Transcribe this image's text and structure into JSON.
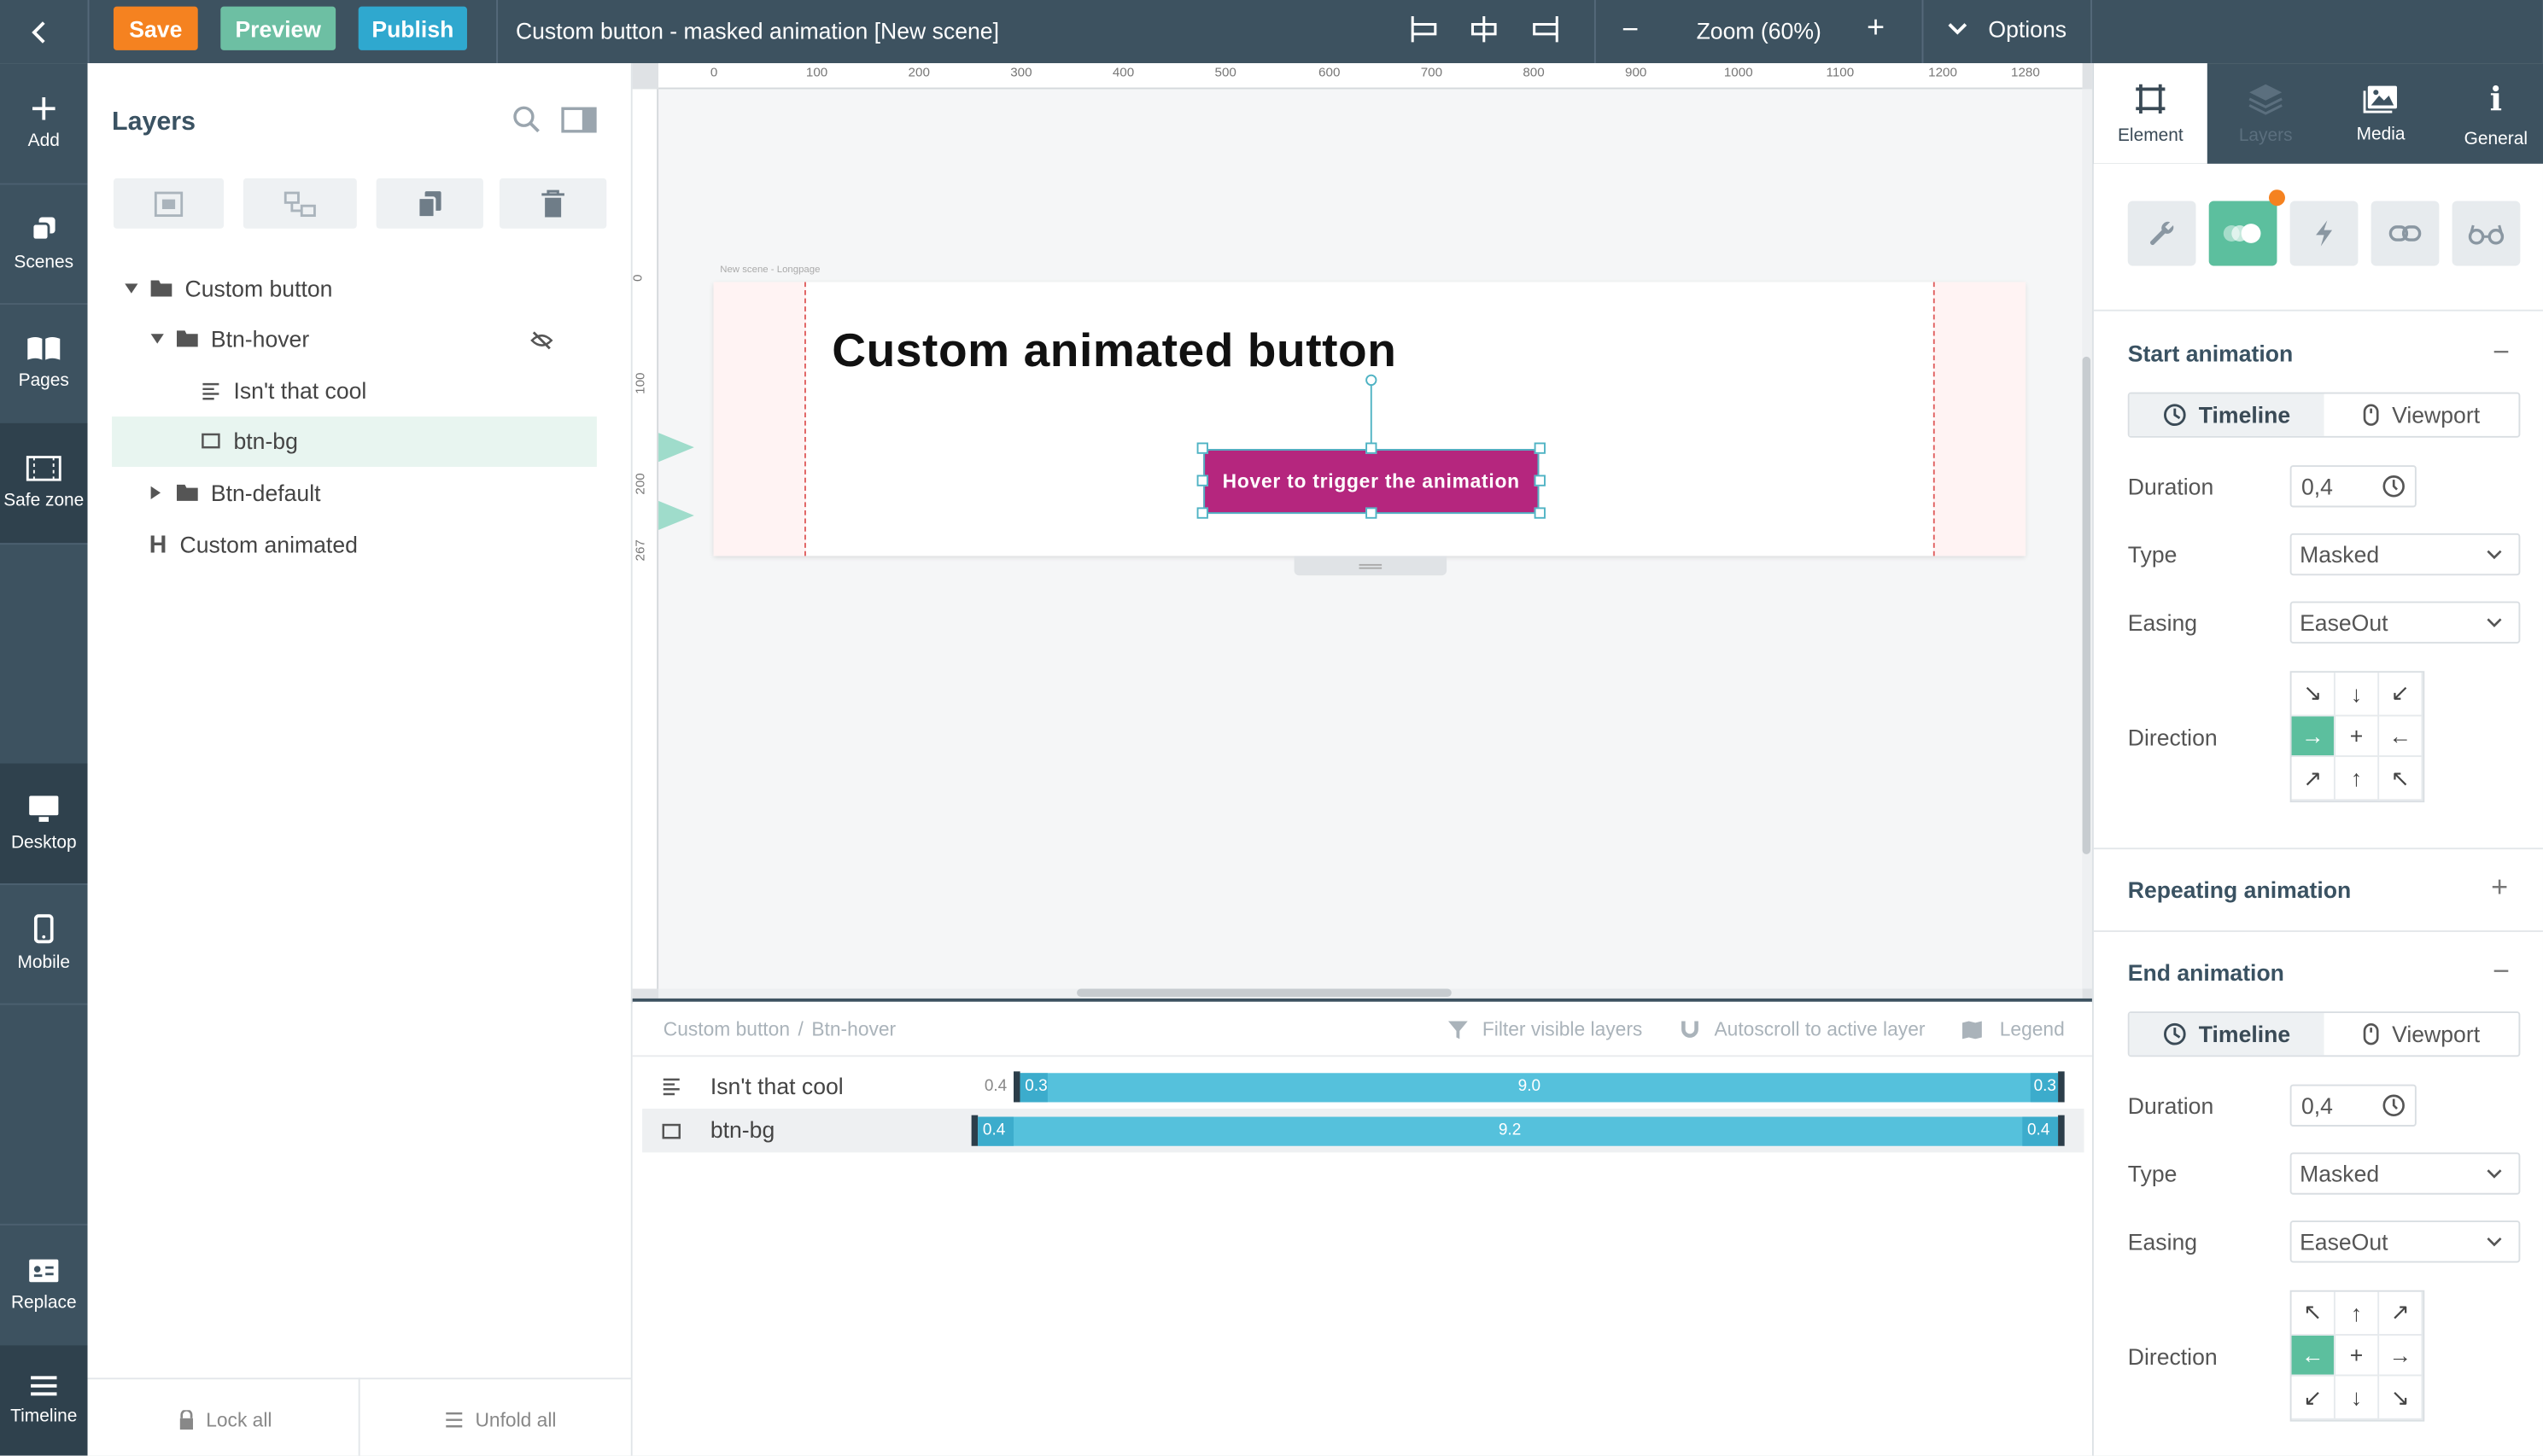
{
  "topbar": {
    "save": "Save",
    "preview": "Preview",
    "publish": "Publish",
    "title": "Custom button - masked animation [New scene]",
    "zoom": "Zoom (60%)",
    "options": "Options",
    "minus": "−",
    "plus": "+"
  },
  "leftbar": {
    "add": "Add",
    "scenes": "Scenes",
    "pages": "Pages",
    "safe_zone": "Safe zone",
    "desktop": "Desktop",
    "mobile": "Mobile",
    "replace": "Replace",
    "timeline": "Timeline"
  },
  "layers": {
    "title": "Layers",
    "items": [
      {
        "label": "Custom button"
      },
      {
        "label": "Btn-hover"
      },
      {
        "label": "Isn't that cool"
      },
      {
        "label": "btn-bg"
      },
      {
        "label": "Btn-default"
      },
      {
        "label": "Custom animated"
      }
    ],
    "lock_all": "Lock all",
    "unfold_all": "Unfold all"
  },
  "canvas": {
    "ruler_x": [
      "0",
      "100",
      "200",
      "300",
      "400",
      "500",
      "600",
      "700",
      "800",
      "900",
      "1000",
      "1100",
      "1200",
      "1280"
    ],
    "ruler_y": [
      "0",
      "100",
      "200",
      "267"
    ],
    "page_label": "New scene - Longpage",
    "heading": "Custom animated button",
    "button_text": "Hover to trigger the animation"
  },
  "timeline": {
    "breadcrumb_root": "Custom button",
    "breadcrumb_sep": "/",
    "breadcrumb_child": "Btn-hover",
    "filter": "Filter visible layers",
    "autoscroll": "Autoscroll to active layer",
    "legend": "Legend",
    "rows": [
      {
        "label": "Isn't that cool",
        "start_outside": "0.4",
        "start": "0.3",
        "mid": "9.0",
        "end": "0.3"
      },
      {
        "label": "btn-bg",
        "start": "0.4",
        "mid": "9.2",
        "end": "0.4"
      }
    ]
  },
  "rightpanel": {
    "tabs": [
      "Element",
      "Layers",
      "Media",
      "General"
    ],
    "start": {
      "title": "Start animation",
      "mode_timeline": "Timeline",
      "mode_viewport": "Viewport",
      "duration_label": "Duration",
      "duration": "0,4",
      "type_label": "Type",
      "type": "Masked",
      "easing_label": "Easing",
      "easing": "EaseOut",
      "direction_label": "Direction",
      "arrows": [
        "↘",
        "↓",
        "↙",
        "→",
        "+",
        "←",
        "↗",
        "↑",
        "↖"
      ]
    },
    "repeating": {
      "title": "Repeating animation"
    },
    "end": {
      "title": "End animation",
      "mode_timeline": "Timeline",
      "mode_viewport": "Viewport",
      "duration_label": "Duration",
      "duration": "0,4",
      "type_label": "Type",
      "type": "Masked",
      "easing_label": "Easing",
      "easing": "EaseOut",
      "direction_label": "Direction",
      "arrows": [
        "↖",
        "↑",
        "↗",
        "←",
        "+",
        "→",
        "↙",
        "↓",
        "↘"
      ]
    }
  },
  "colors": {
    "topbar": "#3d5260",
    "save": "#f58220",
    "preview": "#6dbfa3",
    "publish": "#2fa8cf",
    "accent_green": "#5cbf9e",
    "button_magenta": "#b5267e",
    "timeline_bar": "#55c1dc"
  }
}
